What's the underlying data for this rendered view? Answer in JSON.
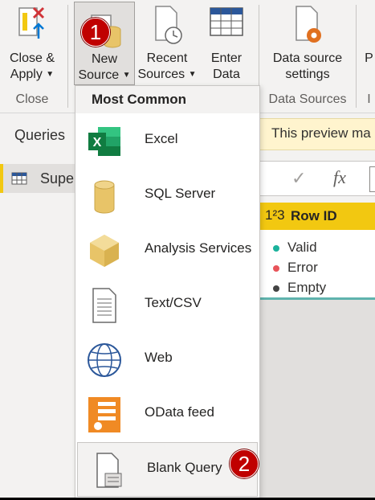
{
  "ribbon": {
    "close_apply": {
      "line1": "Close &",
      "line2": "Apply"
    },
    "new_source": {
      "line1": "New",
      "line2": "Source"
    },
    "recent_sources": {
      "line1": "Recent",
      "line2": "Sources"
    },
    "enter_data": {
      "line1": "Enter",
      "line2": "Data"
    },
    "data_source_settings": {
      "line1": "Data source",
      "line2": "settings"
    },
    "partial_button": "P",
    "groups": {
      "close": "Close",
      "data_sources": "Data Sources",
      "partial": "I"
    }
  },
  "queries": {
    "title": "Queries",
    "item": "Supe"
  },
  "preview_banner": "This preview ma",
  "formula": {
    "check": "✓",
    "fx": "fx"
  },
  "column": {
    "type_icon": "1²3",
    "header": "Row ID"
  },
  "quality": [
    {
      "label": "Valid",
      "color": "#1bb29c"
    },
    {
      "label": "Error",
      "color": "#e8545a"
    },
    {
      "label": "Empty",
      "color": "#444444"
    }
  ],
  "menu": {
    "header": "Most Common",
    "items": [
      {
        "label": "Excel",
        "icon": "excel-icon"
      },
      {
        "label": "SQL Server",
        "icon": "database-icon"
      },
      {
        "label": "Analysis Services",
        "icon": "cube-icon"
      },
      {
        "label": "Text/CSV",
        "icon": "document-icon"
      },
      {
        "label": "Web",
        "icon": "globe-icon"
      },
      {
        "label": "OData feed",
        "icon": "odata-icon"
      },
      {
        "label": "Blank Query",
        "icon": "blank-query-icon"
      }
    ]
  },
  "badges": {
    "one": "1",
    "two": "2"
  }
}
